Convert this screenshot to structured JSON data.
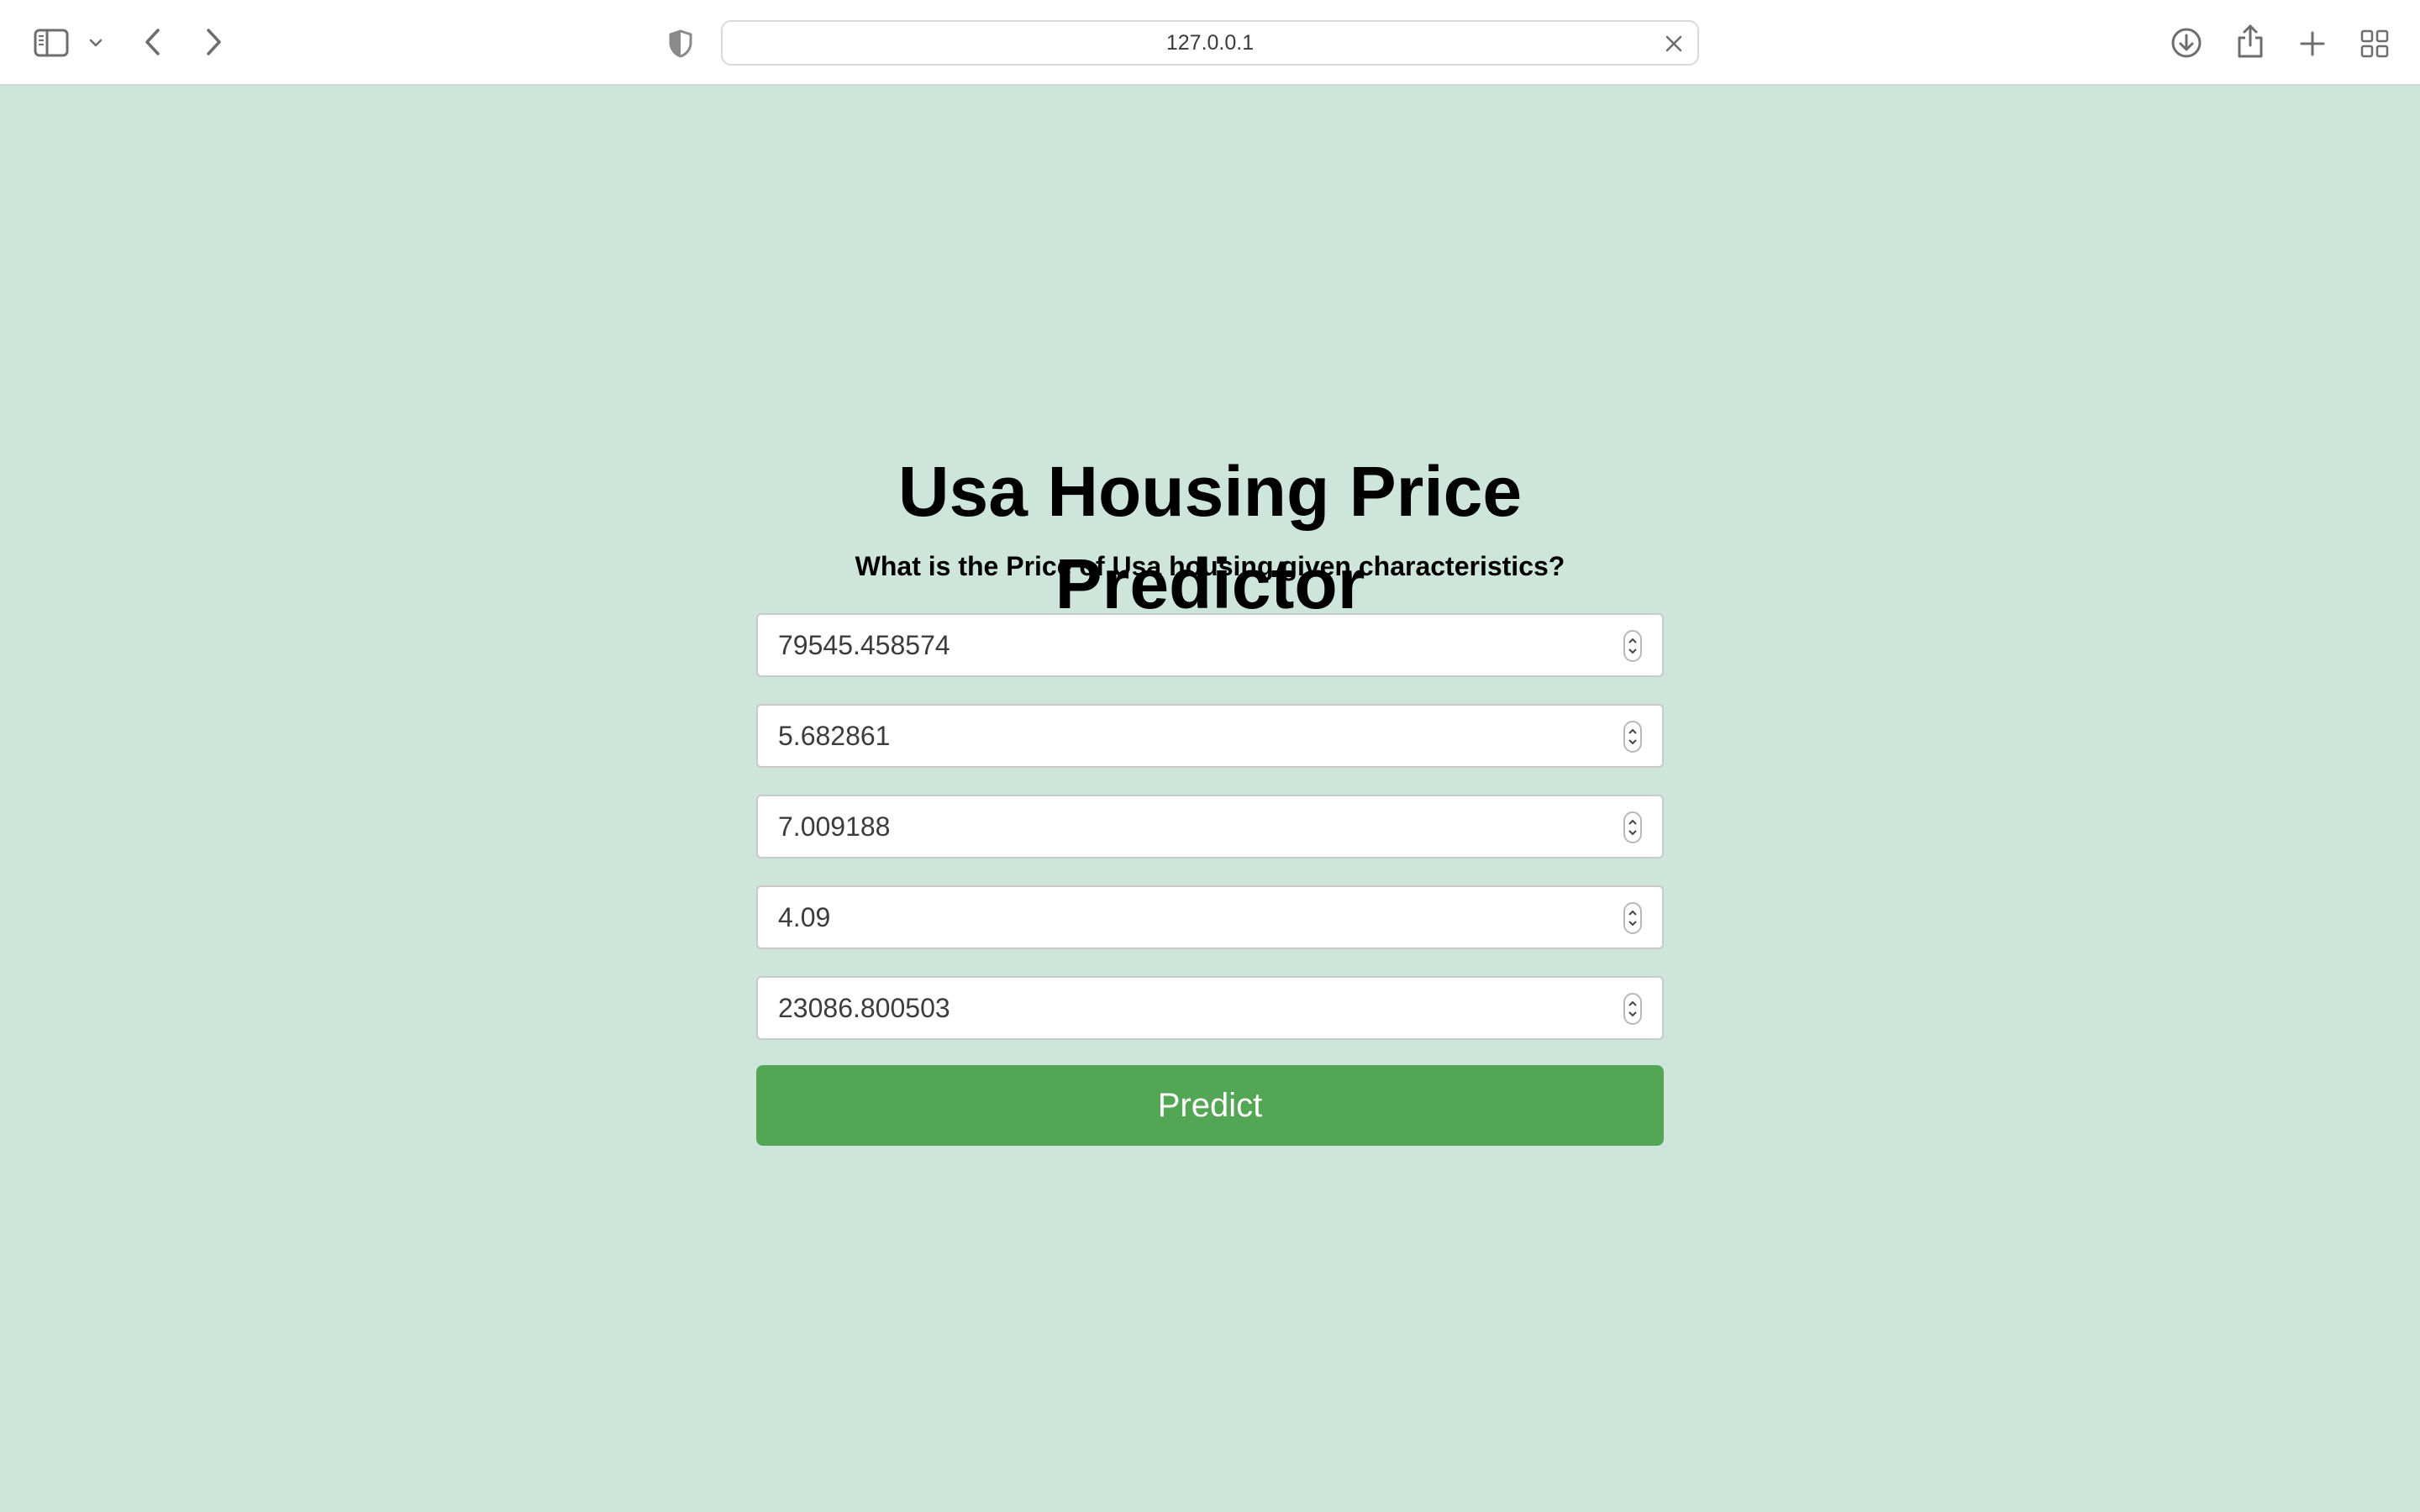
{
  "browser": {
    "address": "127.0.0.1",
    "icons": [
      "sidebar-icon",
      "chevron-down-icon",
      "back-icon",
      "forward-icon",
      "shield-icon",
      "clear-icon",
      "download-icon",
      "share-icon",
      "new-tab-icon",
      "tab-overview-icon"
    ]
  },
  "page": {
    "title": "Usa Housing Price Predictor",
    "subtitle": "What is the Price of Usa housing given characteristics?",
    "fields": [
      {
        "value": "79545.458574"
      },
      {
        "value": "5.682861"
      },
      {
        "value": "7.009188"
      },
      {
        "value": "4.09"
      },
      {
        "value": "23086.800503"
      }
    ],
    "predict_label": "Predict"
  },
  "colors": {
    "background": "#cde5da",
    "button": "#53a653",
    "button_text": "#ffffff"
  }
}
